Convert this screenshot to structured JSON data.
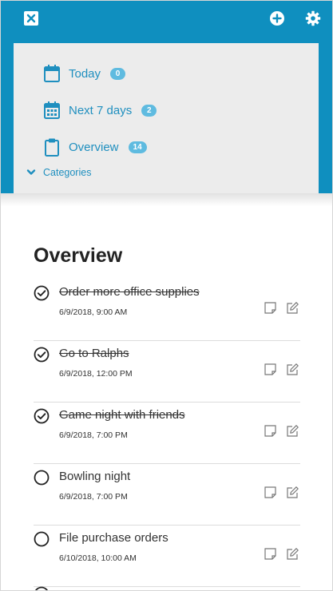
{
  "drawer": {
    "items": [
      {
        "label": "Today",
        "count": "0"
      },
      {
        "label": "Next 7 days",
        "count": "2"
      },
      {
        "label": "Overview",
        "count": "14"
      }
    ],
    "categories_label": "Categories"
  },
  "main": {
    "title": "Overview",
    "tasks": [
      {
        "title": "Order more office supplies",
        "date": "6/9/2018, 9:00 AM",
        "completed": true
      },
      {
        "title": "Go to Ralphs",
        "date": "6/9/2018, 12:00 PM",
        "completed": true
      },
      {
        "title": "Game night with friends",
        "date": "6/9/2018, 7:00 PM",
        "completed": true
      },
      {
        "title": "Bowling night",
        "date": "6/9/2018, 7:00 PM",
        "completed": false
      },
      {
        "title": "File purchase orders",
        "date": "6/10/2018, 10:00 AM",
        "completed": false
      }
    ]
  },
  "colors": {
    "header": "#0f8fbf",
    "drawer": "#ececec",
    "accent": "#1f8fbf",
    "badge": "#5fbbe0"
  },
  "icons": {
    "close": "close-icon",
    "add": "add-circle-icon",
    "settings": "gear-icon",
    "today": "calendar-icon",
    "next7": "calendar-grid-icon",
    "overview": "clipboard-icon",
    "categories": "chevron-down-icon",
    "complete": "check-circle-icon",
    "incomplete": "empty-circle-icon",
    "note": "note-icon",
    "edit": "edit-icon"
  }
}
